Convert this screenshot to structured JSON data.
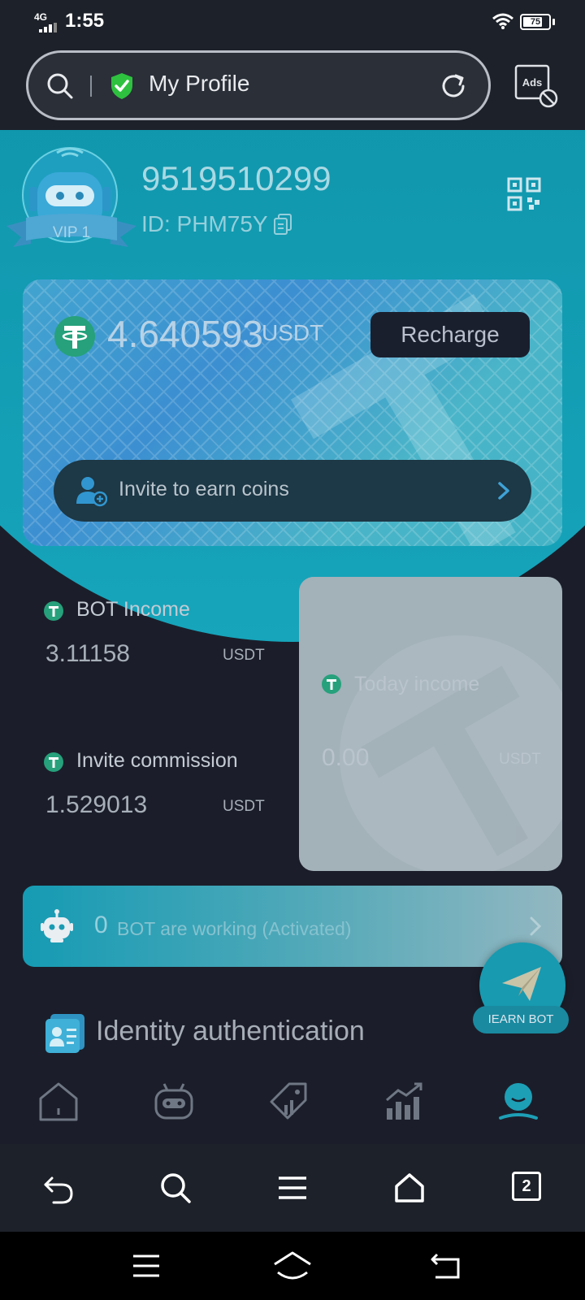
{
  "status_bar": {
    "network": "4G",
    "time": "1:55",
    "battery": "75",
    "battery_level": 0.75
  },
  "browser": {
    "title": "My Profile",
    "ads_label": "Ads",
    "tab_count": "2"
  },
  "profile": {
    "vip_label": "VIP 1",
    "phone": "9519510299",
    "user_id": "ID: PHM75Y",
    "balance": "4.640593",
    "balance_unit": "USDT",
    "recharge_label": "Recharge",
    "invite_label": "Invite to earn coins"
  },
  "stats": {
    "bot_income": {
      "label": "BOT Income",
      "value": "3.11158",
      "unit": "USDT"
    },
    "invite_commission": {
      "label": "Invite commission",
      "value": "1.529013",
      "unit": "USDT"
    },
    "today_income": {
      "label": "Today income",
      "value": "0.00",
      "unit": "USDT"
    }
  },
  "bot_status": {
    "count": "0",
    "text": "BOT are working (Activated)"
  },
  "identity": {
    "label": "Identity authentication"
  },
  "earn_bot": {
    "label": "IEARN BOT"
  },
  "tabs": [
    {
      "icon": "home-icon"
    },
    {
      "icon": "robot-icon"
    },
    {
      "icon": "tag-icon"
    },
    {
      "icon": "chart-icon"
    },
    {
      "icon": "profile-icon",
      "active": true
    }
  ],
  "colors": {
    "accent": "#16a5bb",
    "background": "#1b1e2a",
    "tether": "#26a17b"
  }
}
